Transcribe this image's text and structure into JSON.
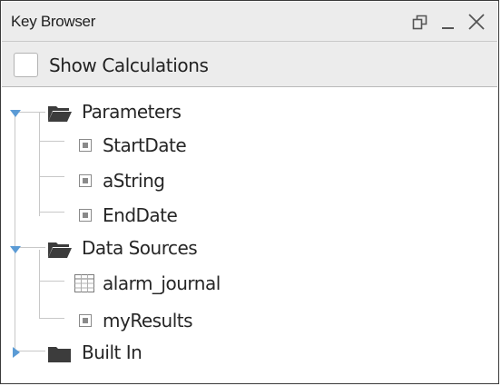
{
  "panel": {
    "title": "Key Browser",
    "buttons": [
      {
        "name": "restore-icon",
        "label": "Restore"
      },
      {
        "name": "minimize-icon",
        "label": "Minimize"
      },
      {
        "name": "close-icon",
        "label": "Close"
      }
    ]
  },
  "options": {
    "show_calculations_label": "Show Calculations",
    "show_calculations_checked": false
  },
  "tree": {
    "parameters": {
      "label": "Parameters",
      "expanded": true,
      "children": [
        {
          "label": "StartDate",
          "icon": "value-icon"
        },
        {
          "label": "aString",
          "icon": "value-icon"
        },
        {
          "label": "EndDate",
          "icon": "value-icon"
        }
      ]
    },
    "data_sources": {
      "label": "Data Sources",
      "expanded": true,
      "children": [
        {
          "label": "alarm_journal",
          "icon": "table-icon"
        },
        {
          "label": "myResults",
          "icon": "value-icon"
        }
      ]
    },
    "built_in": {
      "label": "Built In",
      "expanded": false
    }
  },
  "colors": {
    "folder": "#3c3c3c",
    "expander": "#5b9bd5",
    "guide": "#c8c8c8"
  }
}
